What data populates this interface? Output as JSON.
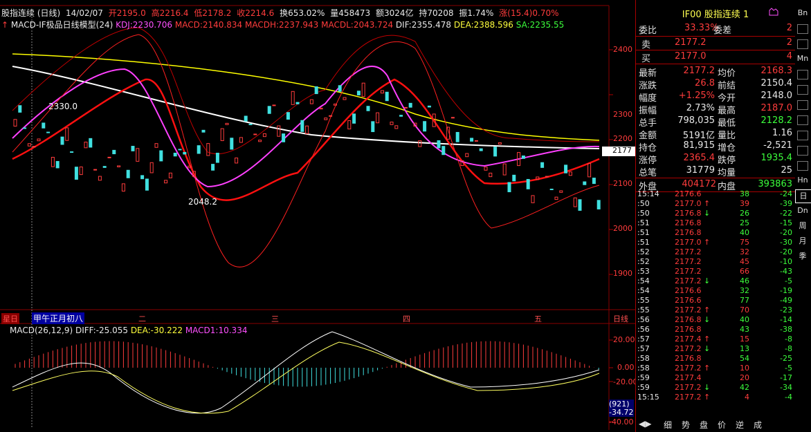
{
  "info": {
    "title": "股指连续 (日线)",
    "date": "14/02/07",
    "open": "开2195.0",
    "high": "高2216.4",
    "low": "低2178.2",
    "close": "收2214.6",
    "turnover": "换653.02%",
    "volume": "量458473",
    "amount": "额3024亿",
    "oi": "持70208",
    "amplitude": "振1.74%",
    "change": "涨(15.4)0.70%"
  },
  "indicator": {
    "name": "MACD-IF极品日线模型(24)",
    "kdj": "KDJ:2230.706",
    "macd": "MACD:2140.834",
    "macdh": "MACDH:2237.943",
    "macdl": "MACDL:2043.724",
    "dif": "DIF:2355.478",
    "dea": "DEA:2388.596",
    "sa": "SA:2235.55"
  },
  "chart_labels": {
    "high_mark": "2330.0",
    "low_mark": "2048.2",
    "current_price": "2177",
    "lunar": "甲午正月初八",
    "tag_left": "星日",
    "weekday_2": "二",
    "weekday_3": "三",
    "weekday_4": "四",
    "weekday_5": "五",
    "period": "日线"
  },
  "price_axis": [
    "2400",
    "2300",
    "2200",
    "2100",
    "2000",
    "1900"
  ],
  "macd": {
    "name": "MACD(26,12,9)",
    "diff": "DIFF:-25.055",
    "dea": "DEA:-30.222",
    "macd1": "MACD1:10.334",
    "axis": [
      "20.00",
      "0.00",
      "-20.00",
      "-40.00"
    ],
    "box_a": "(921)",
    "box_b": "-34.72"
  },
  "panel": {
    "code": "IF00",
    "name": "股指连续",
    "num": "1",
    "weibi_label": "委比",
    "weibi": "33.33%",
    "weicha_label": "委差",
    "weicha": "2",
    "sell_label": "卖",
    "sell_price": "2177.2",
    "sell_vol": "2",
    "buy_label": "买",
    "buy_price": "2177.0",
    "buy_vol": "4",
    "rows": [
      {
        "l1": "最新",
        "v1": "2177.2",
        "l2": "均价",
        "v2": "2168.3",
        "c1": "r",
        "c2": "r"
      },
      {
        "l1": "涨跌",
        "v1": "26.8",
        "l2": "前结",
        "v2": "2150.4",
        "c1": "r",
        "c2": "w"
      },
      {
        "l1": "幅度",
        "v1": "+1.25%",
        "l2": "今开",
        "v2": "2148.0",
        "c1": "r",
        "c2": "w"
      },
      {
        "l1": "振幅",
        "v1": "2.73%",
        "l2": "最高",
        "v2": "2187.0",
        "c1": "w",
        "c2": "r"
      },
      {
        "l1": "总手",
        "v1": "798,035",
        "l2": "最低",
        "v2": "2128.2",
        "c1": "w",
        "c2": "g"
      },
      {
        "l1": "金额",
        "v1": "5191亿",
        "l2": "量比",
        "v2": "1.16",
        "c1": "w",
        "c2": "w"
      },
      {
        "l1": "持仓",
        "v1": "81,915",
        "l2": "增仓",
        "v2": "-2,521",
        "c1": "w",
        "c2": "w"
      },
      {
        "l1": "涨停",
        "v1": "2365.4",
        "l2": "跌停",
        "v2": "1935.4",
        "c1": "r",
        "c2": "g"
      },
      {
        "l1": "总笔",
        "v1": "31779",
        "l2": "均量",
        "v2": "25",
        "c1": "w",
        "c2": "w"
      }
    ],
    "outer_label": "外盘",
    "outer": "404172",
    "inner_label": "内盘",
    "inner": "393863",
    "trades": [
      {
        "t": "15:14",
        "p": "2176.6",
        "a": "",
        "v": "38",
        "d": "-24",
        "vc": "g"
      },
      {
        "t": ":50",
        "p": "2177.0",
        "a": "↑",
        "v": "39",
        "d": "-39",
        "vc": "r"
      },
      {
        "t": ":50",
        "p": "2176.8",
        "a": "↓",
        "v": "26",
        "d": "-22",
        "vc": "g"
      },
      {
        "t": ":51",
        "p": "2176.8",
        "a": "",
        "v": "25",
        "d": "-15",
        "vc": "g"
      },
      {
        "t": ":51",
        "p": "2176.8",
        "a": "",
        "v": "40",
        "d": "-20",
        "vc": "g"
      },
      {
        "t": ":51",
        "p": "2177.0",
        "a": "↑",
        "v": "75",
        "d": "-30",
        "vc": "r"
      },
      {
        "t": ":52",
        "p": "2177.2",
        "a": "",
        "v": "32",
        "d": "-20",
        "vc": "r"
      },
      {
        "t": ":52",
        "p": "2177.2",
        "a": "",
        "v": "45",
        "d": "-10",
        "vc": "r"
      },
      {
        "t": ":53",
        "p": "2177.2",
        "a": "",
        "v": "66",
        "d": "-43",
        "vc": "r"
      },
      {
        "t": ":54",
        "p": "2177.2",
        "a": "↓",
        "v": "46",
        "d": "-5",
        "vc": "g"
      },
      {
        "t": ":54",
        "p": "2176.6",
        "a": "",
        "v": "32",
        "d": "-19",
        "vc": "g"
      },
      {
        "t": ":55",
        "p": "2176.6",
        "a": "",
        "v": "77",
        "d": "-49",
        "vc": "g"
      },
      {
        "t": ":55",
        "p": "2177.2",
        "a": "↑",
        "v": "70",
        "d": "-23",
        "vc": "r"
      },
      {
        "t": ":56",
        "p": "2176.8",
        "a": "↓",
        "v": "40",
        "d": "-14",
        "vc": "g"
      },
      {
        "t": ":56",
        "p": "2176.8",
        "a": "",
        "v": "43",
        "d": "-38",
        "vc": "g"
      },
      {
        "t": ":57",
        "p": "2177.4",
        "a": "↑",
        "v": "15",
        "d": "-8",
        "vc": "r"
      },
      {
        "t": ":57",
        "p": "2177.2",
        "a": "↓",
        "v": "13",
        "d": "-8",
        "vc": "g"
      },
      {
        "t": ":58",
        "p": "2176.8",
        "a": "",
        "v": "54",
        "d": "-25",
        "vc": "g"
      },
      {
        "t": ":58",
        "p": "2177.2",
        "a": "↑",
        "v": "10",
        "d": "-5",
        "vc": "r"
      },
      {
        "t": ":59",
        "p": "2177.4",
        "a": "",
        "v": "20",
        "d": "-17",
        "vc": "r"
      },
      {
        "t": ":59",
        "p": "2177.2",
        "a": "↓",
        "v": "42",
        "d": "-34",
        "vc": "g"
      },
      {
        "t": "15:15",
        "p": "2177.2",
        "a": "↑",
        "v": "4",
        "d": "-4",
        "vc": "r"
      }
    ]
  },
  "side_tabs": [
    "Bn",
    "",
    "",
    "Mn",
    "",
    "",
    "",
    "",
    "",
    "",
    "",
    "Hn",
    "日",
    "Dn",
    "周",
    "月",
    "季"
  ],
  "bottom_tabs": [
    "细",
    "势",
    "盘",
    "价",
    "逆",
    "成"
  ],
  "colors": {
    "up": "#ff3c3c",
    "down": "#40e0e0",
    "ma_white": "#ffffff",
    "ma_yellow": "#ffff00",
    "magenta": "#ff40ff",
    "red_line": "#ff1010"
  }
}
